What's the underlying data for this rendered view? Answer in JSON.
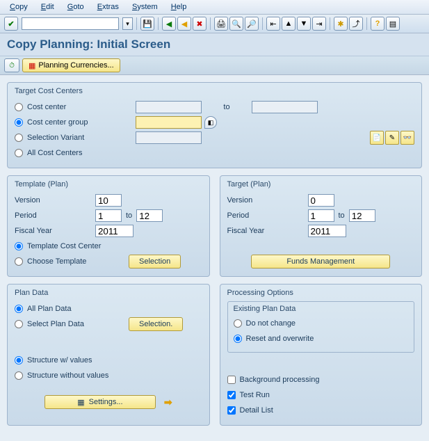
{
  "menu": [
    "Copy",
    "Edit",
    "Goto",
    "Extras",
    "System",
    "Help"
  ],
  "title": "Copy Planning: Initial Screen",
  "subbar": {
    "planning_currencies": "Planning Currencies..."
  },
  "group_target_cc": {
    "title": "Target Cost Centers",
    "cost_center": "Cost center",
    "to": "to",
    "cost_center_group": "Cost center group",
    "selection_variant": "Selection Variant",
    "all_cost_centers": "All Cost Centers"
  },
  "group_template": {
    "title": "Template (Plan)",
    "version": "Version",
    "version_val": "10",
    "period": "Period",
    "period_from": "1",
    "to": "to",
    "period_to": "12",
    "fiscal_year": "Fiscal Year",
    "fiscal_year_val": "2011",
    "template_cc": "Template Cost Center",
    "choose_template": "Choose Template",
    "selection_btn": "Selection"
  },
  "group_target": {
    "title": "Target (Plan)",
    "version": "Version",
    "version_val": "0",
    "period": "Period",
    "period_from": "1",
    "to": "to",
    "period_to": "12",
    "fiscal_year": "Fiscal Year",
    "fiscal_year_val": "2011",
    "funds_btn": "Funds Management"
  },
  "group_plan_data": {
    "title": "Plan Data",
    "all_plan_data": "All Plan Data",
    "select_plan_data": "Select Plan Data",
    "selection_btn": "Selection.",
    "structure_values": "Structure w/ values",
    "structure_without": "Structure without values",
    "settings_btn": "Settings..."
  },
  "group_processing": {
    "title": "Processing Options",
    "existing_title": "Existing Plan Data",
    "do_not_change": "Do not change",
    "reset_overwrite": "Reset and overwrite",
    "background": "Background processing",
    "test_run": "Test Run",
    "detail_list": "Detail List"
  }
}
